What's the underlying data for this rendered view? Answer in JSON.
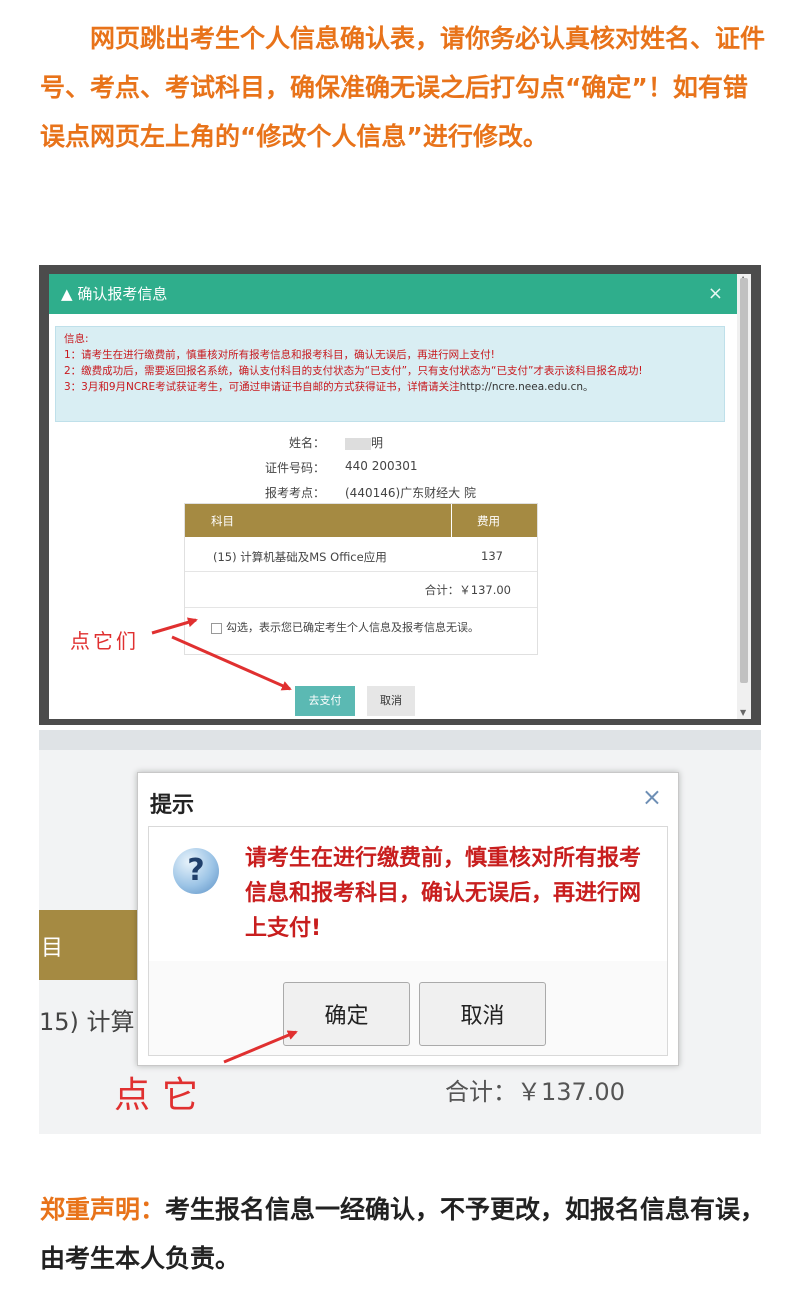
{
  "intro_text": "网页跳出考生个人信息确认表，请你务必认真核对姓名、证件号、考点、考试科目，确保准确无误之后打勾点“确定”！如有错误点网页左上角的“修改个人信息”进行修改。",
  "modal1": {
    "title": "确认报考信息",
    "close_label": "×",
    "info": {
      "heading": "信息:",
      "line1": "1：请考生在进行缴费前，慎重核对所有报考信息和报考科目，确认无误后，再进行网上支付!",
      "line2": "2：缴费成功后，需要返回报名系统，确认支付科目的支付状态为“已支付”，只有支付状态为“已支付”才表示该科目报名成功!",
      "line3_prefix": "3：3月和9月NCRE考试获证考生，可通过申请证书自邮的方式获得证书，详情请关注",
      "line3_url": "http://ncre.neea.edu.cn。"
    },
    "fields": {
      "name_label": "姓名：",
      "name_value": "明",
      "id_label": "证件号码：",
      "id_value": "440  200301",
      "site_label": "报考考点：",
      "site_value": "(440146)广东财经大  院"
    },
    "table": {
      "col_subject": "科目",
      "col_fee": "费用",
      "row_subject": "(15) 计算机基础及MS Office应用",
      "row_fee": "137",
      "total": "合计：￥137.00"
    },
    "agree_text": "勾选，表示您已确定考生个人信息及报考信息无误。",
    "pay_button": "去支付",
    "cancel_button": "取消"
  },
  "annotation1": "点它们",
  "modal2_background": {
    "subject_fragment": "目",
    "course_fragment": "15) 计算",
    "total": "合计：￥137.00"
  },
  "dialog": {
    "title": "提示",
    "close_label": "×",
    "icon_glyph": "?",
    "message": "请考生在进行缴费前，慎重核对所有报考信息和报考科目，确认无误后，再进行网上支付!",
    "ok_button": "确定",
    "cancel_button": "取消"
  },
  "annotation2": "点它",
  "disclaimer": {
    "label": "郑重声明：",
    "text": "考生报名信息一经确认，不予更改，如报名信息有误，由考生本人负责。"
  },
  "colors": {
    "intro_orange": "#e8731a",
    "modal_header": "#2fae8c",
    "table_header_gold": "#a58a42",
    "warning_red": "#c81e1e",
    "annotation_red": "#e03030"
  }
}
